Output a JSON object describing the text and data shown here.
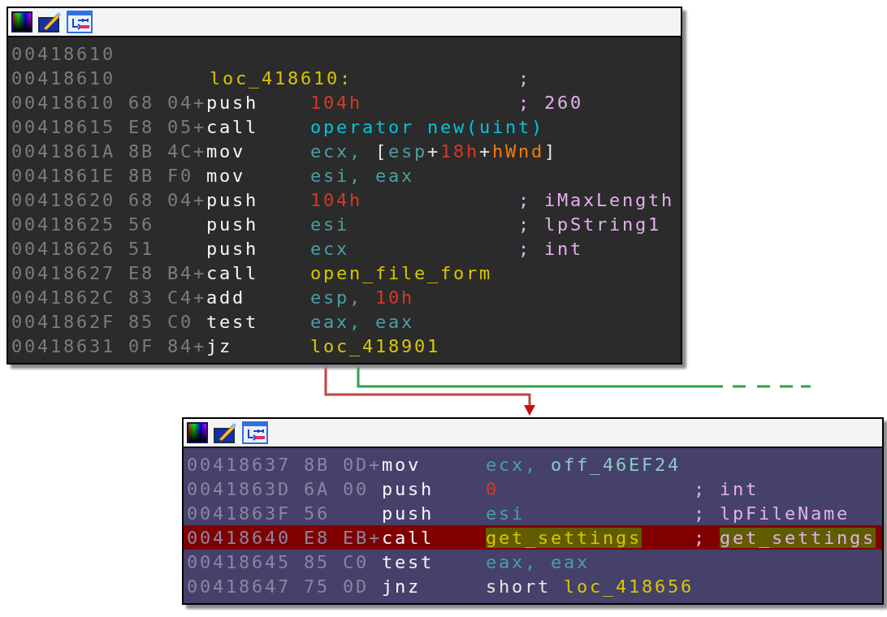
{
  "blocks": [
    {
      "lines": [
        {
          "kind": "blank",
          "address": "00418610",
          "selected": false
        },
        {
          "kind": "label",
          "address": "00418610",
          "label": "loc_418610:",
          "comment": [
            [
              {
                "text": ";",
                "kind": "comment"
              }
            ]
          ],
          "selected": false
        },
        {
          "kind": "insn",
          "address": "00418610",
          "bytes": "68 04+",
          "mnemonic": "push",
          "operands": [
            [
              {
                "text": "104h",
                "kind": "num"
              }
            ]
          ],
          "comment": [
            [
              {
                "text": ";",
                "kind": "comment"
              }
            ],
            [
              {
                "text": "260",
                "kind": "comment"
              }
            ]
          ],
          "selected": false
        },
        {
          "kind": "insn",
          "address": "00418615",
          "bytes": "E8 05+",
          "mnemonic": "call",
          "operands": [
            [
              {
                "text": "operator new(uint)",
                "kind": "func"
              }
            ]
          ],
          "selected": false
        },
        {
          "kind": "insn",
          "address": "0041861A",
          "bytes": "8B 4C+",
          "mnemonic": "mov",
          "operands": [
            [
              {
                "text": "ecx,",
                "kind": "reg"
              }
            ],
            [
              {
                "text": "[",
                "kind": "plain"
              },
              {
                "text": "esp",
                "kind": "reg"
              },
              {
                "text": "+",
                "kind": "plain"
              },
              {
                "text": "18h",
                "kind": "num"
              },
              {
                "text": "+",
                "kind": "plain"
              },
              {
                "text": "hWnd",
                "kind": "var"
              },
              {
                "text": "]",
                "kind": "plain"
              }
            ]
          ],
          "selected": false
        },
        {
          "kind": "insn",
          "address": "0041861E",
          "bytes": "8B F0",
          "mnemonic": "mov",
          "operands": [
            [
              {
                "text": "esi,",
                "kind": "reg"
              }
            ],
            [
              {
                "text": "eax",
                "kind": "reg"
              }
            ]
          ],
          "selected": false
        },
        {
          "kind": "insn",
          "address": "00418620",
          "bytes": "68 04+",
          "mnemonic": "push",
          "operands": [
            [
              {
                "text": "104h",
                "kind": "num"
              }
            ]
          ],
          "comment": [
            [
              {
                "text": ";",
                "kind": "comment"
              }
            ],
            [
              {
                "text": "iMaxLength",
                "kind": "comment"
              }
            ]
          ],
          "selected": false
        },
        {
          "kind": "insn",
          "address": "00418625",
          "bytes": "56",
          "mnemonic": "push",
          "operands": [
            [
              {
                "text": "esi",
                "kind": "reg"
              }
            ]
          ],
          "comment": [
            [
              {
                "text": ";",
                "kind": "comment"
              }
            ],
            [
              {
                "text": "lpString1",
                "kind": "comment"
              }
            ]
          ],
          "selected": false
        },
        {
          "kind": "insn",
          "address": "00418626",
          "bytes": "51",
          "mnemonic": "push",
          "operands": [
            [
              {
                "text": "ecx",
                "kind": "reg"
              }
            ]
          ],
          "comment": [
            [
              {
                "text": ";",
                "kind": "comment"
              }
            ],
            [
              {
                "text": "int",
                "kind": "comment"
              }
            ]
          ],
          "selected": false
        },
        {
          "kind": "insn",
          "address": "00418627",
          "bytes": "E8 B4+",
          "mnemonic": "call",
          "operands": [
            [
              {
                "text": "open_file_form",
                "kind": "name"
              }
            ]
          ],
          "selected": false
        },
        {
          "kind": "insn",
          "address": "0041862C",
          "bytes": "83 C4+",
          "mnemonic": "add",
          "operands": [
            [
              {
                "text": "esp,",
                "kind": "reg"
              }
            ],
            [
              {
                "text": "10h",
                "kind": "num"
              }
            ]
          ],
          "selected": false
        },
        {
          "kind": "insn",
          "address": "0041862F",
          "bytes": "85 C0",
          "mnemonic": "test",
          "operands": [
            [
              {
                "text": "eax,",
                "kind": "reg"
              }
            ],
            [
              {
                "text": "eax",
                "kind": "reg"
              }
            ]
          ],
          "selected": false
        },
        {
          "kind": "insn",
          "address": "00418631",
          "bytes": "0F 84+",
          "mnemonic": "jz",
          "operands": [
            [
              {
                "text": "loc_418901",
                "kind": "name"
              }
            ]
          ],
          "selected": false
        }
      ]
    },
    {
      "lines": [
        {
          "kind": "insn",
          "address": "00418637",
          "bytes": "8B 0D+",
          "mnemonic": "mov",
          "operands": [
            [
              {
                "text": "ecx,",
                "kind": "reg"
              }
            ],
            [
              {
                "text": "off_46EF24",
                "kind": "data"
              }
            ]
          ],
          "selected": false
        },
        {
          "kind": "insn",
          "address": "0041863D",
          "bytes": "6A 00",
          "mnemonic": "push",
          "operands": [
            [
              {
                "text": "0",
                "kind": "num"
              }
            ]
          ],
          "comment": [
            [
              {
                "text": ";",
                "kind": "comment"
              }
            ],
            [
              {
                "text": "int",
                "kind": "comment"
              }
            ]
          ],
          "selected": false
        },
        {
          "kind": "insn",
          "address": "0041863F",
          "bytes": "56",
          "mnemonic": "push",
          "operands": [
            [
              {
                "text": "esi",
                "kind": "reg"
              }
            ]
          ],
          "comment": [
            [
              {
                "text": ";",
                "kind": "comment"
              }
            ],
            [
              {
                "text": "lpFileName",
                "kind": "comment"
              }
            ]
          ],
          "selected": false
        },
        {
          "kind": "insn",
          "address": "00418640",
          "bytes": "E8 EB+",
          "mnemonic": "call",
          "operands": [
            [
              {
                "text": "get_settings",
                "kind": "name",
                "highlight": true
              }
            ]
          ],
          "comment": [
            [
              {
                "text": ";",
                "kind": "comment"
              }
            ],
            [
              {
                "text": "get_settings",
                "kind": "comment",
                "highlight": true
              }
            ]
          ],
          "selected": true
        },
        {
          "kind": "insn",
          "address": "00418645",
          "bytes": "85 C0",
          "mnemonic": "test",
          "operands": [
            [
              {
                "text": "eax,",
                "kind": "reg"
              }
            ],
            [
              {
                "text": "eax",
                "kind": "reg"
              }
            ]
          ],
          "selected": false
        },
        {
          "kind": "insn",
          "address": "00418647",
          "bytes": "75 0D",
          "mnemonic": "jnz",
          "operands": [
            [
              {
                "text": "short",
                "kind": "plain"
              }
            ],
            [
              {
                "text": "loc_418656",
                "kind": "name"
              }
            ]
          ],
          "selected": false
        }
      ]
    }
  ]
}
